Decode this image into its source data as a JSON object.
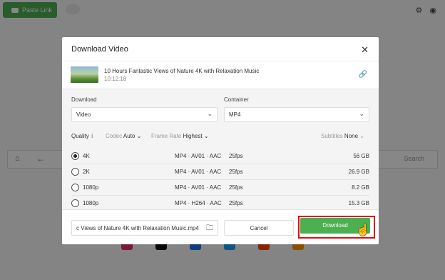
{
  "background": {
    "paste_link": "Paste Link",
    "search_label": "Search",
    "accent": "#4caf50"
  },
  "dialog": {
    "title": "Download Video",
    "video": {
      "title": "10 Hours Fantastic Views of Nature 4K with Relaxation Music",
      "duration": "10:12:18"
    },
    "download_label": "Download",
    "download_value": "Video",
    "container_label": "Container",
    "container_value": "MP4",
    "filters": {
      "quality": "Quality",
      "codec_label": "Codec",
      "codec_value": "Auto",
      "frame_label": "Frame Rate",
      "frame_value": "Highest",
      "subs_label": "Subtitles",
      "subs_value": "None"
    },
    "qualities": [
      {
        "res": "4K",
        "format": "MP4 · AV01 · AAC",
        "fps": "25fps",
        "size": "56 GB",
        "selected": true
      },
      {
        "res": "2K",
        "format": "MP4 · AV01 · AAC",
        "fps": "25fps",
        "size": "26.9 GB",
        "selected": false
      },
      {
        "res": "1080p",
        "format": "MP4 · AV01 · AAC",
        "fps": "25fps",
        "size": "8.2 GB",
        "selected": false
      },
      {
        "res": "1080p",
        "format": "MP4 · H264 · AAC",
        "fps": "25fps",
        "size": "15.3 GB",
        "selected": false
      }
    ],
    "filename": "c Views of Nature 4K with Relaxation Music.mp4",
    "cancel_label": "Cancel",
    "download_button": "Download",
    "highlight_color": "#e01010"
  }
}
